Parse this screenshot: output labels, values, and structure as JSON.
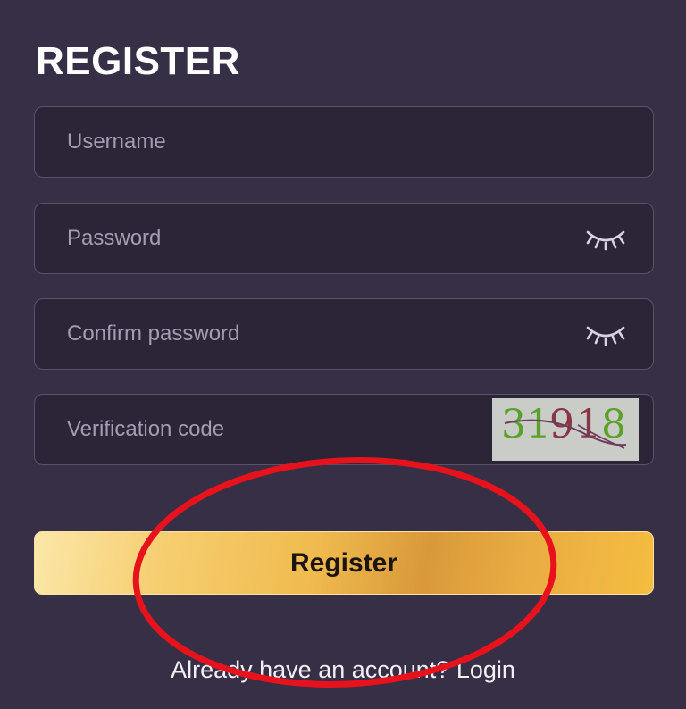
{
  "page": {
    "title": "REGISTER"
  },
  "form": {
    "username": {
      "placeholder": "Username",
      "value": ""
    },
    "password": {
      "placeholder": "Password",
      "value": ""
    },
    "confirm_password": {
      "placeholder": "Confirm password",
      "value": ""
    },
    "verification_code": {
      "placeholder": "Verification code",
      "value": "",
      "captcha_text": "31918"
    },
    "eye_icon": "eye-closed-icon",
    "register_label": "Register"
  },
  "footer": {
    "prompt": "Already have an account?",
    "login_label": "Login"
  },
  "colors": {
    "background": "#372f45",
    "field_background": "#2c2538",
    "button_gold": "#f0bb4f",
    "annotation_red": "#e8121c",
    "captcha_green": "#5aa12a",
    "captcha_maroon": "#8a3546"
  }
}
